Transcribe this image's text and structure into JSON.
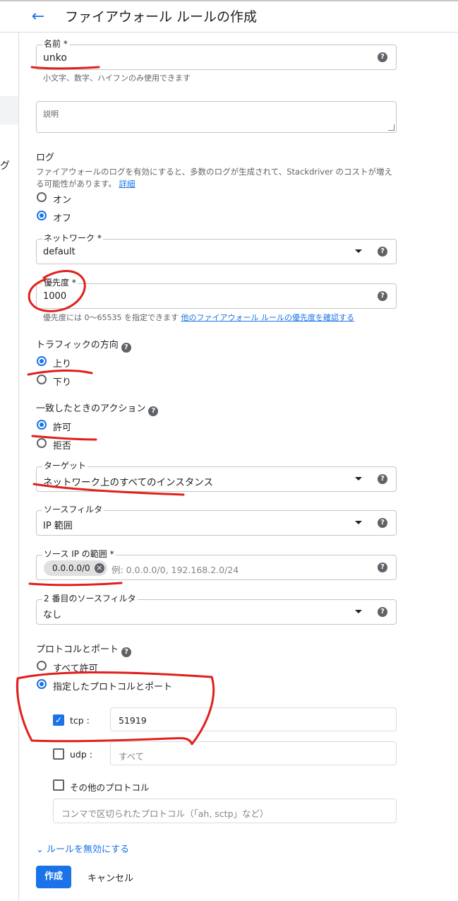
{
  "header": {
    "back_icon": "arrow-back-icon",
    "title": "ファイアウォール ルールの作成"
  },
  "leftnav": {
    "clipped_text": "グ"
  },
  "name": {
    "label": "名前 *",
    "value": "unko",
    "hint": "小文字、数字、ハイフンのみ使用できます"
  },
  "description": {
    "label": "説明",
    "value": ""
  },
  "logs": {
    "title": "ログ",
    "desc": "ファイアウォールのログを有効にすると、多数のログが生成されて、Stackdriver のコストが増える可能性があります。",
    "link": "詳細",
    "options": [
      {
        "label": "オン",
        "selected": false
      },
      {
        "label": "オフ",
        "selected": true
      }
    ]
  },
  "network": {
    "label": "ネットワーク *",
    "value": "default"
  },
  "priority": {
    "label": "優先度 *",
    "value": "1000",
    "hint": "優先度には 0～65535 を指定できます",
    "hint_link": "他のファイアウォール ルールの優先度を確認する"
  },
  "direction": {
    "title": "トラフィックの方向",
    "options": [
      {
        "label": "上り",
        "selected": true
      },
      {
        "label": "下り",
        "selected": false
      }
    ]
  },
  "action": {
    "title": "一致したときのアクション",
    "options": [
      {
        "label": "許可",
        "selected": true
      },
      {
        "label": "拒否",
        "selected": false
      }
    ]
  },
  "target": {
    "label": "ターゲット",
    "value": "ネットワーク上のすべてのインスタンス"
  },
  "source_filter": {
    "label": "ソースフィルタ",
    "value": "IP 範囲"
  },
  "source_ip": {
    "label": "ソース IP の範囲 *",
    "chip": "0.0.0.0/0",
    "placeholder": "例: 0.0.0.0/0, 192.168.2.0/24"
  },
  "second_filter": {
    "label": "2 番目のソースフィルタ",
    "value": "なし"
  },
  "protocols": {
    "title": "プロトコルとポート",
    "options": [
      {
        "label": "すべて許可",
        "selected": false
      },
      {
        "label": "指定したプロトコルとポート",
        "selected": true
      }
    ],
    "tcp": {
      "label": "tcp :",
      "checked": true,
      "value": "51919"
    },
    "udp": {
      "label": "udp :",
      "checked": false,
      "placeholder": "すべて"
    },
    "other": {
      "label": "その他のプロトコル",
      "checked": false,
      "placeholder": "コンマで区切られたプロトコル（「ah, sctp」など）"
    }
  },
  "disable_rule": "ルールを無効にする",
  "buttons": {
    "create": "作成",
    "cancel": "キャンセル"
  },
  "colors": {
    "accent": "#1a73e8",
    "annotation": "#e0201c"
  }
}
